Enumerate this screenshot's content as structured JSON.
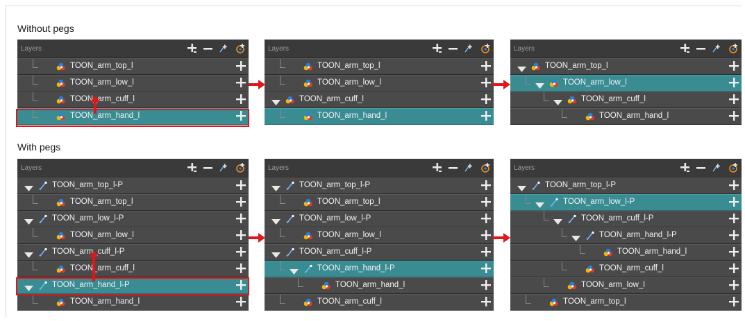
{
  "sections": {
    "without_pegs": "Without pegs",
    "with_pegs": "With pegs"
  },
  "panel_title": "Layers",
  "colors": {
    "panel_bg": "#2c2c2c",
    "row_bg": "#4a4a4a",
    "row_selected": "#3a8c93",
    "highlight": "#e0161b",
    "header_bg": "#3a3a3a"
  },
  "panels": {
    "p1": {
      "rows": [
        {
          "label": "TOON_arm_top_l",
          "type": "drawing"
        },
        {
          "label": "TOON_arm_low_l",
          "type": "drawing"
        },
        {
          "label": "TOON_arm_cuff_l",
          "type": "drawing"
        },
        {
          "label": "TOON_arm_hand_l",
          "type": "drawing",
          "selected": true
        }
      ]
    },
    "p2": {
      "rows": [
        {
          "label": "TOON_arm_top_l",
          "type": "drawing"
        },
        {
          "label": "TOON_arm_low_l",
          "type": "drawing"
        },
        {
          "label": "TOON_arm_cuff_l",
          "type": "drawing",
          "expanded": true
        },
        {
          "label": "TOON_arm_hand_l",
          "type": "drawing",
          "selected": true
        }
      ]
    },
    "p3": {
      "rows": [
        {
          "label": "TOON_arm_top_l",
          "type": "drawing",
          "expanded": true
        },
        {
          "label": "TOON_arm_low_l",
          "type": "drawing",
          "expanded": true,
          "selected": true
        },
        {
          "label": "TOON_arm_cuff_l",
          "type": "drawing",
          "expanded": true
        },
        {
          "label": "TOON_arm_hand_l",
          "type": "drawing"
        }
      ]
    },
    "p4": {
      "rows": [
        {
          "label": "TOON_arm_top_l-P",
          "type": "peg"
        },
        {
          "label": "TOON_arm_top_l",
          "type": "drawing"
        },
        {
          "label": "TOON_arm_low_l-P",
          "type": "peg"
        },
        {
          "label": "TOON_arm_low_l",
          "type": "drawing"
        },
        {
          "label": "TOON_arm_cuff_l-P",
          "type": "peg"
        },
        {
          "label": "TOON_arm_cuff_l",
          "type": "drawing"
        },
        {
          "label": "TOON_arm_hand_l-P",
          "type": "peg",
          "selected": true
        },
        {
          "label": "TOON_arm_hand_l",
          "type": "drawing"
        }
      ]
    },
    "p5": {
      "rows": [
        {
          "label": "TOON_arm_top_l-P",
          "type": "peg"
        },
        {
          "label": "TOON_arm_top_l",
          "type": "drawing"
        },
        {
          "label": "TOON_arm_low_l-P",
          "type": "peg"
        },
        {
          "label": "TOON_arm_low_l",
          "type": "drawing"
        },
        {
          "label": "TOON_arm_cuff_l-P",
          "type": "peg"
        },
        {
          "label": "TOON_arm_hand_l-P",
          "type": "peg",
          "selected": true
        },
        {
          "label": "TOON_arm_hand_l",
          "type": "drawing"
        },
        {
          "label": "TOON_arm_cuff_l",
          "type": "drawing"
        }
      ]
    },
    "p6": {
      "rows": [
        {
          "label": "TOON_arm_top_l-P",
          "type": "peg"
        },
        {
          "label": "TOON_arm_low_l-P",
          "type": "peg",
          "selected": true
        },
        {
          "label": "TOON_arm_cuff_l-P",
          "type": "peg"
        },
        {
          "label": "TOON_arm_hand_l-P",
          "type": "peg"
        },
        {
          "label": "TOON_arm_hand_l",
          "type": "drawing"
        },
        {
          "label": "TOON_arm_cuff_l",
          "type": "drawing"
        },
        {
          "label": "TOON_arm_low_l",
          "type": "drawing"
        },
        {
          "label": "TOON_arm_top_l",
          "type": "drawing"
        }
      ]
    }
  }
}
